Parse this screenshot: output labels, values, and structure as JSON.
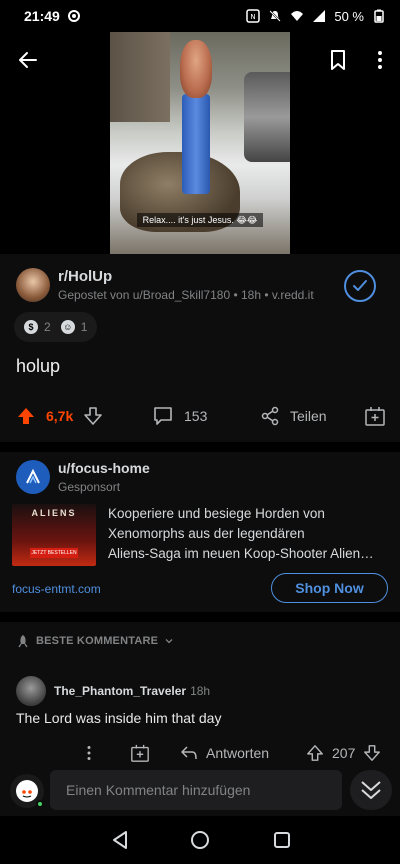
{
  "status_bar": {
    "time": "21:49",
    "battery": "50 %"
  },
  "media": {
    "video_caption": "Relax.... it's just Jesus. 😂😂"
  },
  "post": {
    "subreddit": "r/HolUp",
    "meta": "Gepostet von u/Broad_Skill7180 • 18h • v.redd.it",
    "awards": [
      {
        "icon": "silver-award-icon",
        "count": "2"
      },
      {
        "icon": "wholesome-award-icon",
        "count": "1"
      }
    ],
    "title": "holup",
    "votes": "6,7k",
    "comments": "153",
    "share_label": "Teilen"
  },
  "ad": {
    "user": "u/focus-home",
    "sponsored": "Gesponsort",
    "thumb_logo": "ALIENS",
    "thumb_badge": "JETZT BESTELLEN",
    "text_lines": [
      "Kooperiere und besiege Horden von",
      "Xenomorphs aus der legendären",
      "Aliens-Saga im neuen Koop-Shooter Alien…"
    ],
    "domain": "focus-entmt.com",
    "cta": "Shop Now"
  },
  "comments": {
    "sort_label": "BESTE KOMMENTARE",
    "items": [
      {
        "user": "The_Phantom_Traveler",
        "age": "18h",
        "body": "The Lord was inside him that day",
        "reply_label": "Antworten",
        "votes": "207"
      }
    ]
  },
  "composer": {
    "placeholder": "Einen Kommentar hinzufügen"
  },
  "colors": {
    "upvote": "#ff4500",
    "accent": "#4f8fde",
    "background": "#000000",
    "card": "#0d0d0e"
  }
}
